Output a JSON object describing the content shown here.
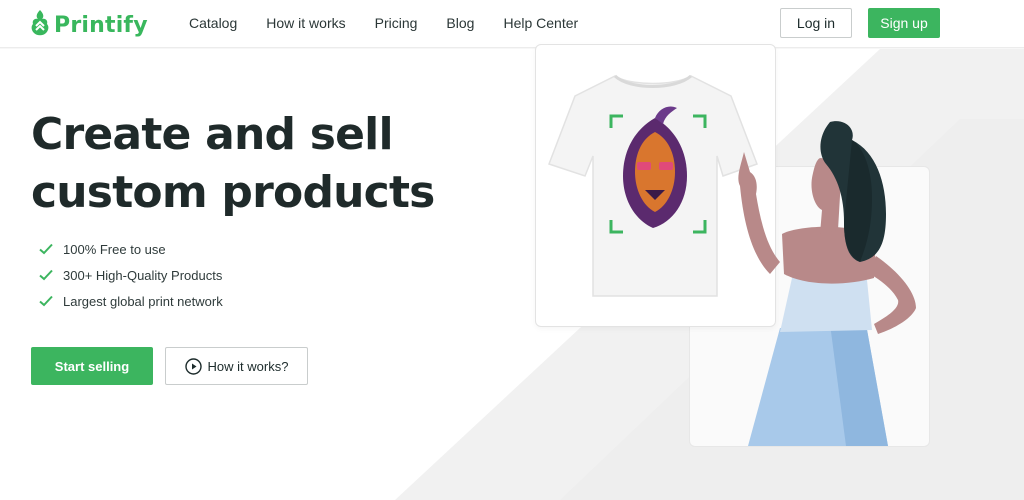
{
  "brand": {
    "name": "Printify",
    "accent": "#3cb55f"
  },
  "nav": {
    "items": [
      "Catalog",
      "How it works",
      "Pricing",
      "Blog",
      "Help Center"
    ]
  },
  "auth": {
    "login_label": "Log in",
    "signup_label": "Sign up"
  },
  "hero": {
    "headline_line1": "Create and sell",
    "headline_line2": "custom products",
    "features": [
      "100% Free to use",
      "300+ High-Quality Products",
      "Largest global print network"
    ],
    "primary_cta": "Start selling",
    "secondary_cta": "How it works?"
  },
  "icons": {
    "logo": "printify-logo-icon",
    "check": "check-icon",
    "play": "play-circle-icon"
  }
}
